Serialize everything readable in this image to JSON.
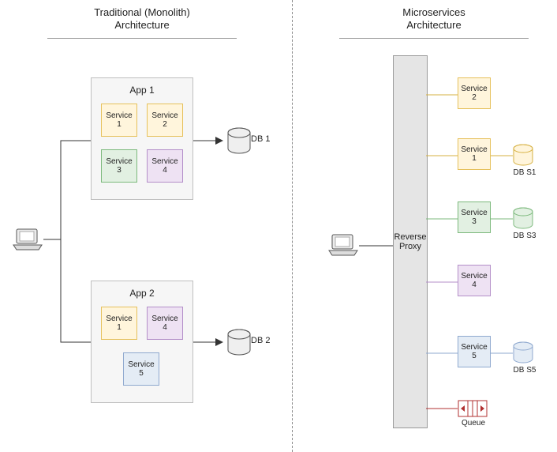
{
  "titles": {
    "left_line1": "Traditional (Monolith)",
    "left_line2": "Architecture",
    "right_line1": "Microservices",
    "right_line2": "Architecture"
  },
  "monolith": {
    "app1": {
      "label": "App 1",
      "services": [
        {
          "label": "Service\n1",
          "color": "yellow"
        },
        {
          "label": "Service\n2",
          "color": "yellow"
        },
        {
          "label": "Service\n3",
          "color": "green"
        },
        {
          "label": "Service\n4",
          "color": "purple"
        }
      ],
      "db_label": "DB 1"
    },
    "app2": {
      "label": "App 2",
      "services": [
        {
          "label": "Service\n1",
          "color": "yellow"
        },
        {
          "label": "Service\n4",
          "color": "purple"
        },
        {
          "label": "Service\n5",
          "color": "blue"
        }
      ],
      "db_label": "DB 2"
    }
  },
  "microservices": {
    "reverse_proxy_label": "Reverse\nProxy",
    "services": [
      {
        "label": "Service\n2",
        "color": "yellow",
        "db": null
      },
      {
        "label": "Service\n1",
        "color": "yellow",
        "db": "DB S1"
      },
      {
        "label": "Service\n3",
        "color": "green",
        "db": "DB S3"
      },
      {
        "label": "Service\n5",
        "color": "blue",
        "db": "DB S5"
      }
    ],
    "service4": {
      "label": "Service\n4",
      "color": "purple"
    },
    "queue_label": "Queue"
  },
  "chart_data": {
    "type": "diagram",
    "title": "Monolith vs Microservices Architecture",
    "left": {
      "name": "Traditional (Monolith) Architecture",
      "client": "laptop",
      "apps": [
        {
          "name": "App 1",
          "services": [
            "Service 1",
            "Service 2",
            "Service 3",
            "Service 4"
          ],
          "database": "DB 1"
        },
        {
          "name": "App 2",
          "services": [
            "Service 1",
            "Service 4",
            "Service 5"
          ],
          "database": "DB 2"
        }
      ]
    },
    "right": {
      "name": "Microservices Architecture",
      "client": "laptop",
      "gateway": "Reverse Proxy",
      "services": [
        {
          "name": "Service 2",
          "database": null
        },
        {
          "name": "Service 1",
          "database": "DB S1"
        },
        {
          "name": "Service 3",
          "database": "DB S3"
        },
        {
          "name": "Service 4",
          "database": null
        },
        {
          "name": "Service 5",
          "database": "DB S5"
        }
      ],
      "queue": "Queue"
    }
  }
}
